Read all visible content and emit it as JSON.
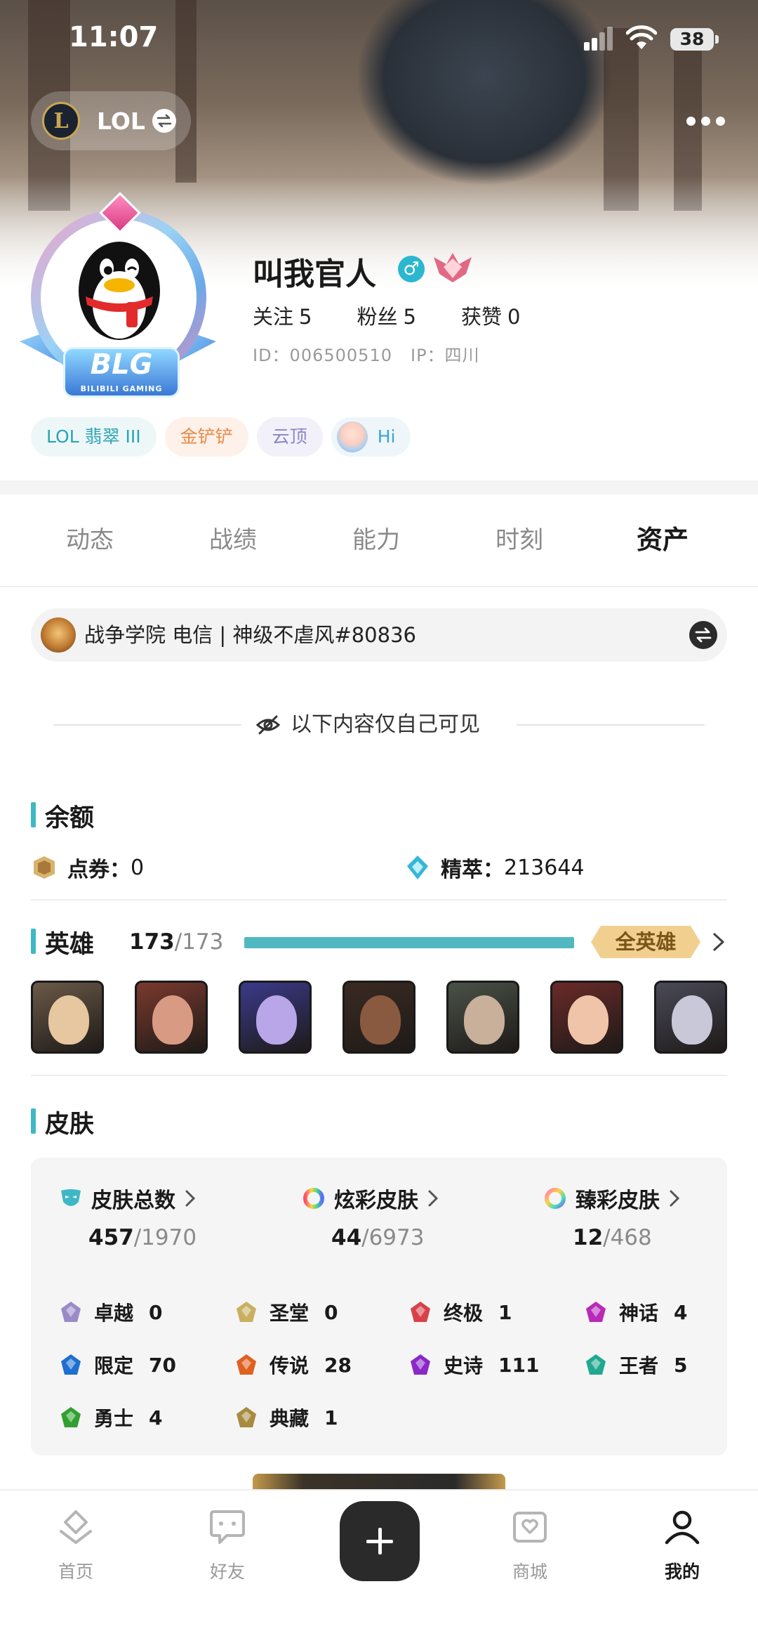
{
  "status_bar": {
    "time": "11:07",
    "battery": "38"
  },
  "header": {
    "game": "LOL"
  },
  "profile": {
    "nickname": "叫我官人",
    "gender_symbol": "♂",
    "avatar_badge": "BLG",
    "avatar_badge_sub": "BILIBILI GAMING",
    "follow_label": "关注",
    "follow_count": "5",
    "fans_label": "粉丝",
    "fans_count": "5",
    "likes_label": "获赞",
    "likes_count": "0",
    "id_text": "ID：006500510",
    "ip_text": "IP：四川"
  },
  "tags": [
    {
      "label": "LOL 翡翠 III"
    },
    {
      "label": "金铲铲"
    },
    {
      "label": "云顶"
    },
    {
      "label": "Hi"
    }
  ],
  "tabs": [
    {
      "label": "动态"
    },
    {
      "label": "战绩"
    },
    {
      "label": "能力"
    },
    {
      "label": "时刻"
    },
    {
      "label": "资产",
      "active": true
    }
  ],
  "account": {
    "text": "战争学院 电信 | 神级不虐风#80836"
  },
  "privacy_note": "以下内容仅自己可见",
  "balance": {
    "title": "余额",
    "points_label": "点券：",
    "points_value": "0",
    "essence_label": "精萃：",
    "essence_value": "213644"
  },
  "heroes": {
    "title": "英雄",
    "owned": "173",
    "total": "/173",
    "progress": 1.0,
    "badge": "全英雄",
    "portraits": [
      {
        "name": "hero-1",
        "bg": "#6a5a48",
        "face": "#e7c7a0"
      },
      {
        "name": "hero-2",
        "bg": "#7a3a2e",
        "face": "#d99a84"
      },
      {
        "name": "hero-3",
        "bg": "#3a3a8a",
        "face": "#b8a6e8"
      },
      {
        "name": "hero-4",
        "bg": "#3a2a22",
        "face": "#8a5a40"
      },
      {
        "name": "hero-5",
        "bg": "#4a5248",
        "face": "#c9b09a"
      },
      {
        "name": "hero-6",
        "bg": "#6a2a28",
        "face": "#f0c4a8"
      },
      {
        "name": "hero-7",
        "bg": "#4a4a58",
        "face": "#c8c8d8"
      }
    ]
  },
  "skins": {
    "title": "皮肤",
    "total_label": "皮肤总数",
    "total_owned": "457",
    "total_all": "/1970",
    "chroma_label": "炫彩皮肤",
    "chroma_owned": "44",
    "chroma_all": "/6973",
    "prestige_label": "臻彩皮肤",
    "prestige_owned": "12",
    "prestige_all": "/468",
    "rarities": [
      {
        "label": "卓越",
        "value": "0",
        "color": "#9a8ac8"
      },
      {
        "label": "圣堂",
        "value": "0",
        "color": "#c9b060"
      },
      {
        "label": "终极",
        "value": "1",
        "color": "#d8404a"
      },
      {
        "label": "神话",
        "value": "4",
        "color": "#b82ab8"
      },
      {
        "label": "限定",
        "value": "70",
        "color": "#1e6fd0"
      },
      {
        "label": "传说",
        "value": "28",
        "color": "#e06020"
      },
      {
        "label": "史诗",
        "value": "111",
        "color": "#8a28c8"
      },
      {
        "label": "王者",
        "value": "5",
        "color": "#20a890"
      },
      {
        "label": "勇士",
        "value": "4",
        "color": "#30a030"
      },
      {
        "label": "典藏",
        "value": "1",
        "color": "#a88a40"
      }
    ]
  },
  "nav": {
    "home": "首页",
    "friends": "好友",
    "shop": "商城",
    "mine": "我的"
  },
  "colors": {
    "accent": "#3fb8c5",
    "badge_gold": "#f1d08f"
  }
}
